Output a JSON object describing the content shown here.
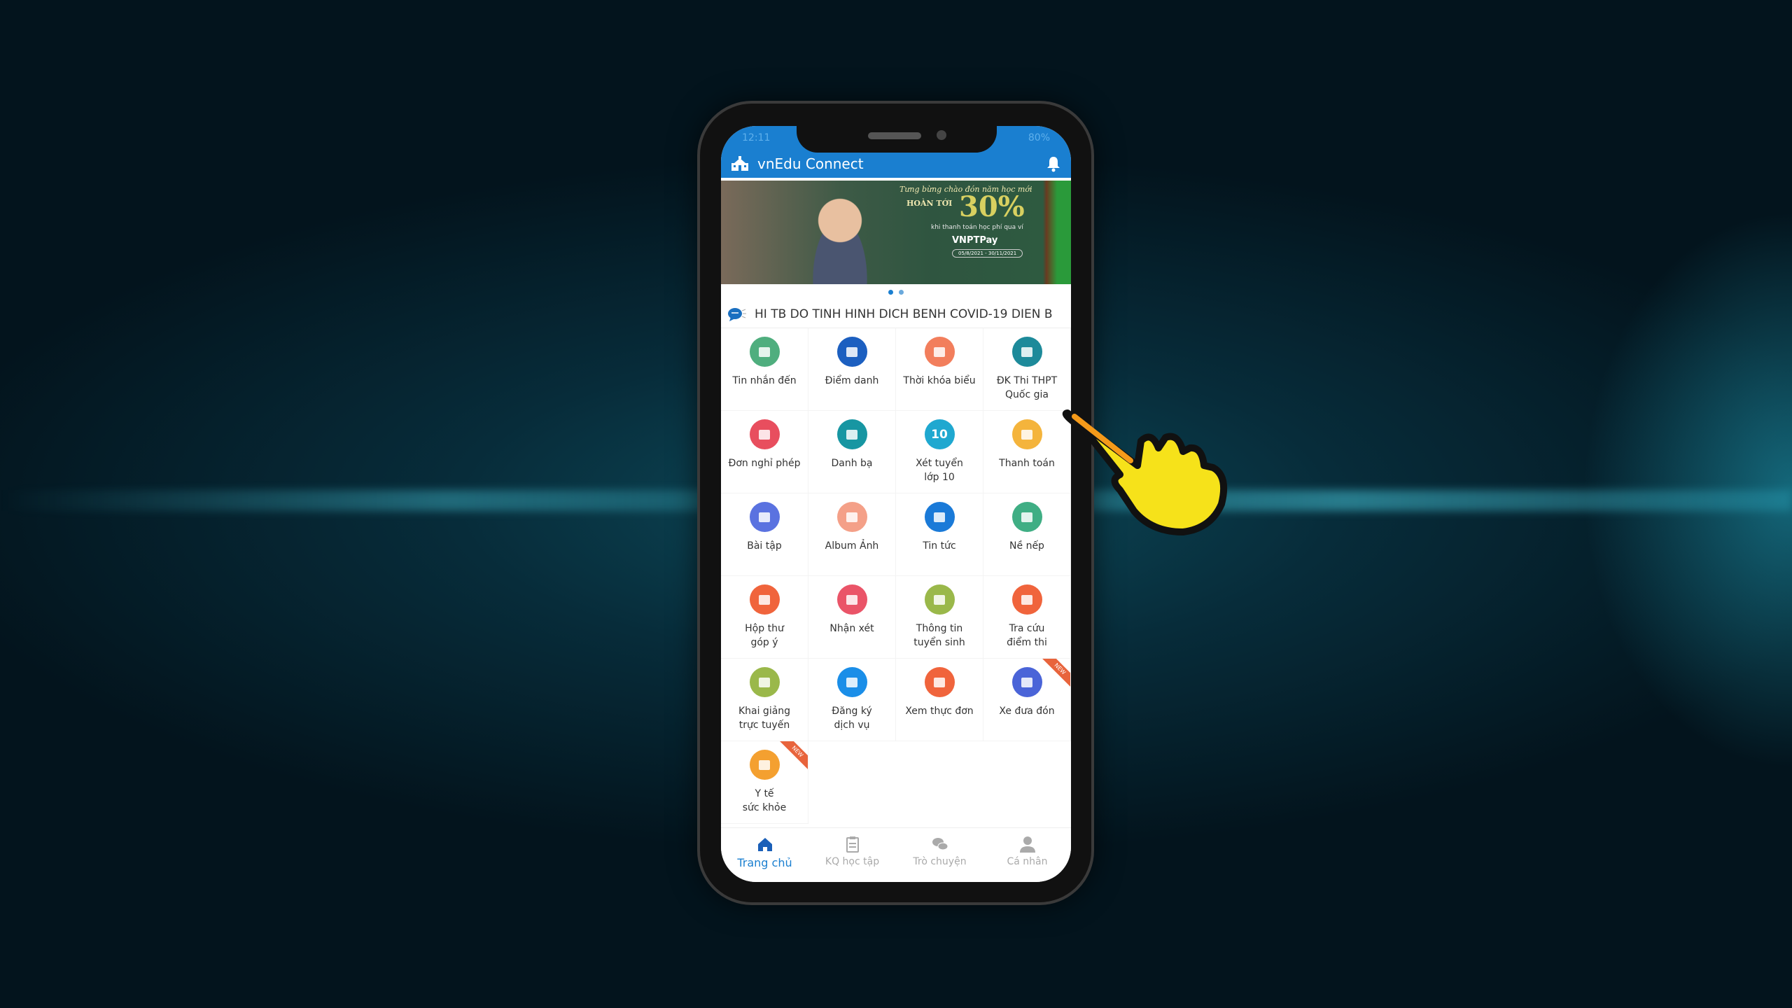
{
  "status_bar": {
    "time": "12:11",
    "battery": "80%"
  },
  "app": {
    "title": "vnEdu Connect",
    "accent": "#1a7fd0"
  },
  "banner": {
    "line1": "Tưng bừng chào đón năm học mới",
    "line2": "HOÀN TỚI",
    "percent": "30%",
    "line3": "khi thanh toán học phí qua ví",
    "brand": "VNPTPay",
    "dates": "05/8/2021 - 30/11/2021",
    "slides": 2,
    "active_slide": 1
  },
  "marquee": {
    "text": "HI TB DO TINH HINH DICH BENH COVID-19 DIEN B"
  },
  "grid": [
    {
      "label": "Tin nhắn đến",
      "icon": "message-icon",
      "color": "#4fae7e"
    },
    {
      "label": "Điểm danh",
      "icon": "alarm-clock-icon",
      "color": "#1c5fc0"
    },
    {
      "label": "Thời khóa biểu",
      "icon": "calendar-icon",
      "color": "#f27e5c"
    },
    {
      "label": "ĐK Thi THPT\nQuốc gia",
      "icon": "school-icon",
      "color": "#1d8a9a"
    },
    {
      "label": "Đơn nghỉ phép",
      "icon": "person-icon",
      "color": "#e84e5e"
    },
    {
      "label": "Danh bạ",
      "icon": "contacts-icon",
      "color": "#1796a2"
    },
    {
      "label": "Xét tuyển\nlớp 10",
      "icon": "ten-icon",
      "color": "#1fa8d0",
      "glyph": "10"
    },
    {
      "label": "Thanh toán",
      "icon": "card-icon",
      "color": "#f4b43c"
    },
    {
      "label": "Bài tập",
      "icon": "grid-icon",
      "color": "#5a72e0"
    },
    {
      "label": "Album Ảnh",
      "icon": "image-icon",
      "color": "#f4a088"
    },
    {
      "label": "Tin tức",
      "icon": "news-icon",
      "color": "#1a7ad8"
    },
    {
      "label": "Nề nếp",
      "icon": "checklist-icon",
      "color": "#3fae84"
    },
    {
      "label": "Hộp thư\ngóp ý",
      "icon": "mailbox-icon",
      "color": "#f0643c"
    },
    {
      "label": "Nhận xét",
      "icon": "comment-icon",
      "color": "#ea5468"
    },
    {
      "label": "Thông tin\ntuyển sinh",
      "icon": "backpack-icon",
      "color": "#9ab84a"
    },
    {
      "label": "Tra cứu\nđiểm thi",
      "icon": "score-icon",
      "color": "#f0643c"
    },
    {
      "label": "Khai giảng\ntrực tuyến",
      "icon": "monitor-icon",
      "color": "#9ab84a"
    },
    {
      "label": "Đăng ký\ndịch vụ",
      "icon": "service-icon",
      "color": "#1a8ee8"
    },
    {
      "label": "Xem thực đơn",
      "icon": "menu-icon",
      "color": "#f0643c"
    },
    {
      "label": "Xe đưa đón",
      "icon": "bus-icon",
      "color": "#4a64d8",
      "badge": "NEW"
    },
    {
      "label": "Y tế\nsức khỏe",
      "icon": "health-icon",
      "color": "#f4a030",
      "badge": "NEW"
    }
  ],
  "bottom_nav": [
    {
      "label": "Trang chủ",
      "icon": "home-icon",
      "active": true
    },
    {
      "label": "KQ học tập",
      "icon": "clipboard-icon"
    },
    {
      "label": "Trò chuyện",
      "icon": "chat-icon"
    },
    {
      "label": "Cá nhân",
      "icon": "user-icon"
    }
  ]
}
